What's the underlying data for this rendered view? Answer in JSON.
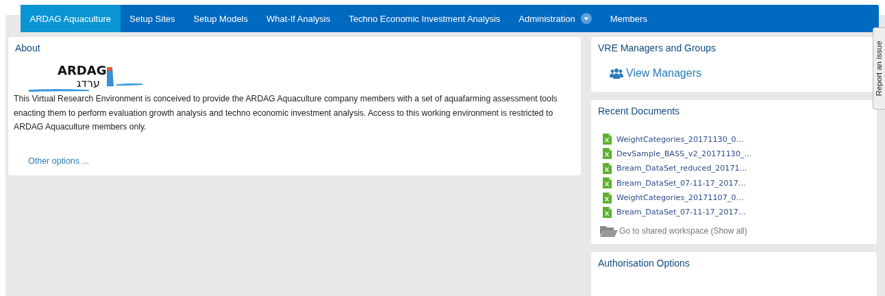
{
  "nav": [
    {
      "label": "ARDAG Aquaculture",
      "selected": true,
      "dropdown": false
    },
    {
      "label": "Setup Sites",
      "selected": false,
      "dropdown": false
    },
    {
      "label": "Setup Models",
      "selected": false,
      "dropdown": false
    },
    {
      "label": "What-If Analysis",
      "selected": false,
      "dropdown": false
    },
    {
      "label": "Techno Economic Investment Analysis",
      "selected": false,
      "dropdown": false
    },
    {
      "label": "Administration",
      "selected": false,
      "dropdown": true
    },
    {
      "label": "Members",
      "selected": false,
      "dropdown": false
    }
  ],
  "about": {
    "title": "About",
    "logo": {
      "latin": "ARDAG",
      "hebrew": "ערדג"
    },
    "text": "This Virtual Research Environment is conceived to provide the ARDAG Aquaculture company members with a set of aquafarming assessment tools enacting them to perform evaluation growth analysis and techno economic investment analysis. Access to this working environment is restricted to ARDAG Aquaculture members only.",
    "link": "Other options ..."
  },
  "managers": {
    "title": "VRE Managers and Groups",
    "link": "View Managers"
  },
  "recent_documents": {
    "title": "Recent Documents",
    "files": [
      "WeightCategories_20171130_0...",
      "DevSample_BASS_v2_20171130_...",
      "Bream_DataSet_reduced_20171...",
      "Bream_DataSet_07-11-17_2017...",
      "WeightCategories_20171107_0...",
      "Bream_DataSet_07-11-17_2017..."
    ],
    "workspace_link": "Go to shared workspace (Show all)"
  },
  "authorisation": {
    "title": "Authorisation Options"
  },
  "report_tab": "Report an issue"
}
